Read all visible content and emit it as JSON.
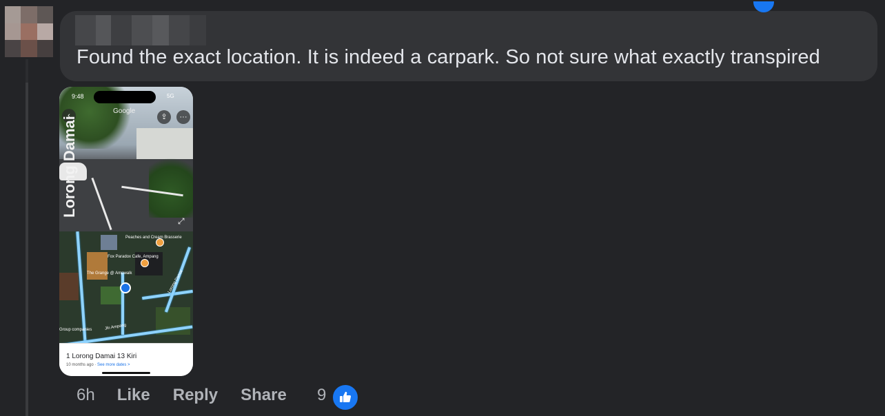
{
  "comment": {
    "text": "Found the exact location. It is indeed a carpark. So not sure what exactly transpired"
  },
  "attachment": {
    "status_time": "9:48",
    "status_signal": "5G",
    "street_view_label": "Lorong Damai",
    "street_view_brand": "Google",
    "map_labels": {
      "poi1": "Peaches and Cream Brasserie",
      "poi2": "Fox Paradox Cafe, Ampang",
      "poi3": "The Grange @ Ampwalk",
      "road1": "Jln Ampang",
      "road2": "Lorong Damai",
      "poi4": "Group companies"
    },
    "card": {
      "address": "1 Lorong Damai 13 Kiri",
      "age": "10 months ago · ",
      "link": "See more dates >"
    }
  },
  "actions": {
    "time": "6h",
    "like": "Like",
    "reply": "Reply",
    "share": "Share",
    "reaction_count": "9"
  },
  "colors": {
    "background": "#232427",
    "bubble": "#333437",
    "accent": "#1877f2",
    "muted_text": "#b0b3b8"
  },
  "icons": {
    "reaction": "thumbs-up-icon"
  }
}
